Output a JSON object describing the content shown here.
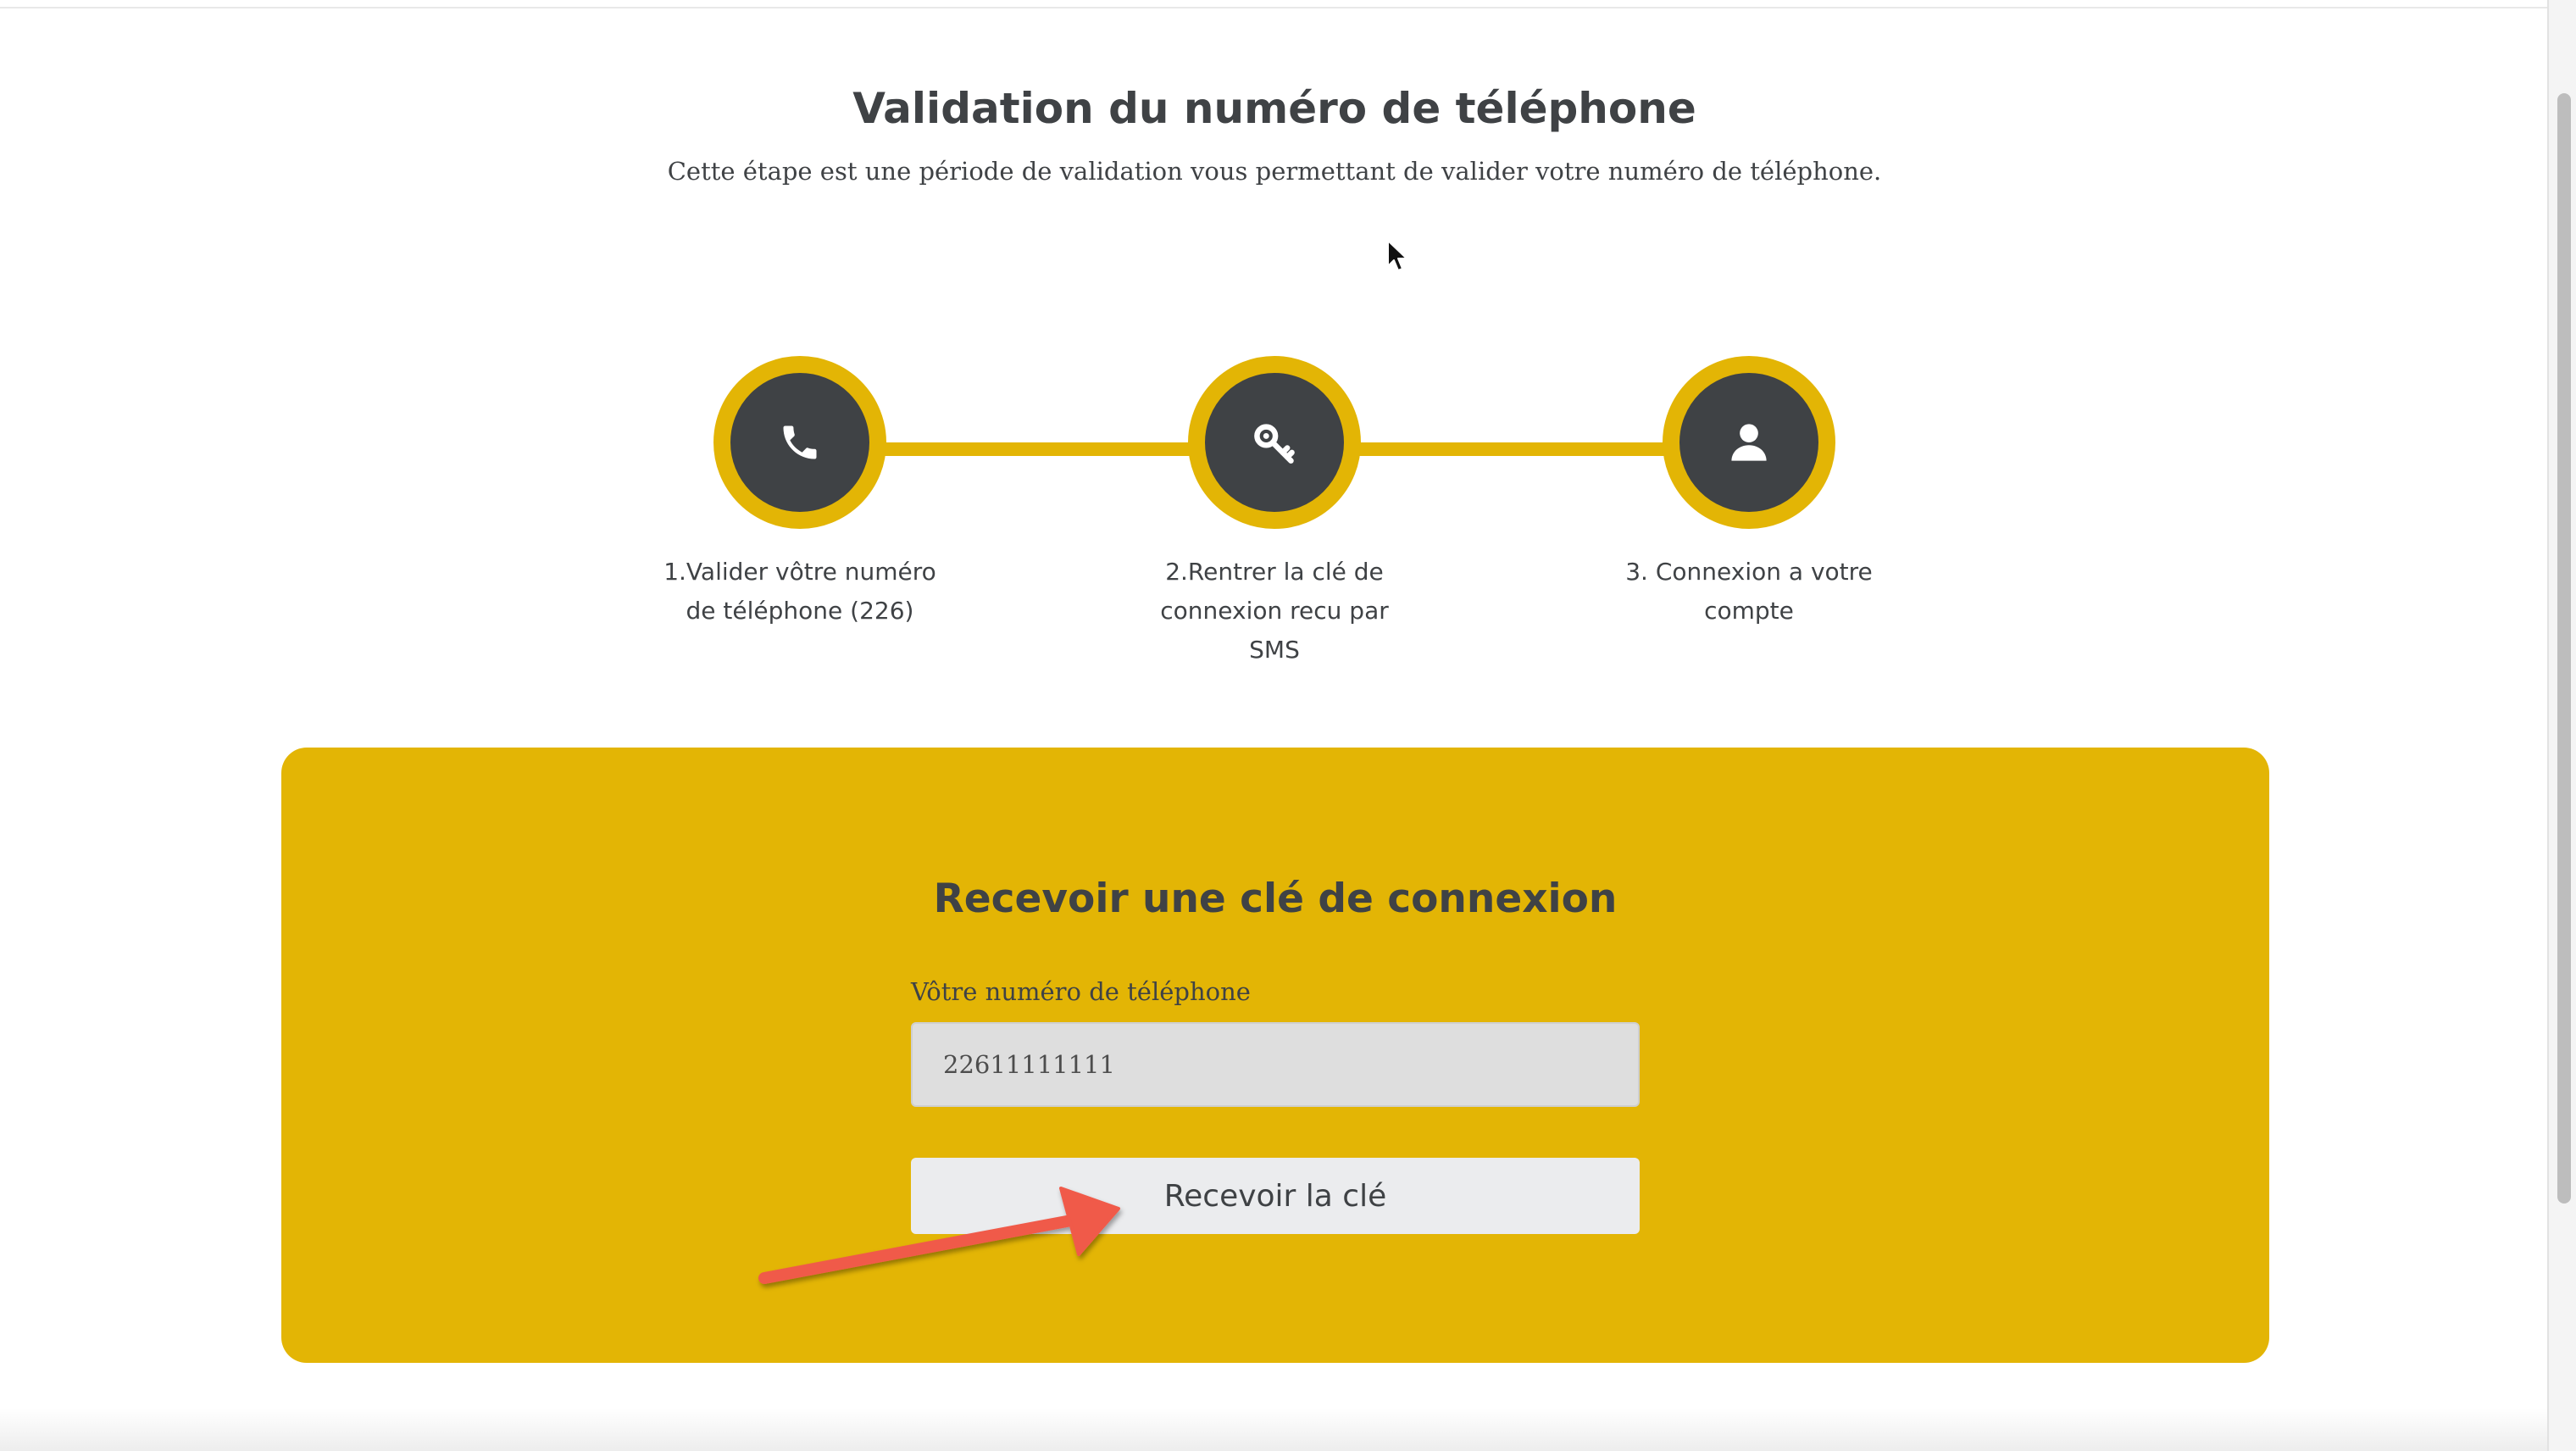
{
  "page": {
    "title": "Validation du numéro de téléphone",
    "subtitle": "Cette étape est une période de validation vous permettant de valider votre numéro de téléphone."
  },
  "steps": [
    {
      "icon": "phone-icon",
      "label": "1.Valider vôtre numéro de téléphone (226)"
    },
    {
      "icon": "key-icon",
      "label": "2.Rentrer la clé de connexion recu par SMS"
    },
    {
      "icon": "user-icon",
      "label": "3. Connexion a votre compte"
    }
  ],
  "form": {
    "title": "Recevoir une clé de connexion",
    "phone_label": "Vôtre numéro de téléphone",
    "phone_value": "22611111111",
    "submit_label": "Recevoir la clé"
  },
  "colors": {
    "accent": "#e3b505",
    "dark": "#3f4245",
    "annotation_arrow": "#f05a4a"
  }
}
